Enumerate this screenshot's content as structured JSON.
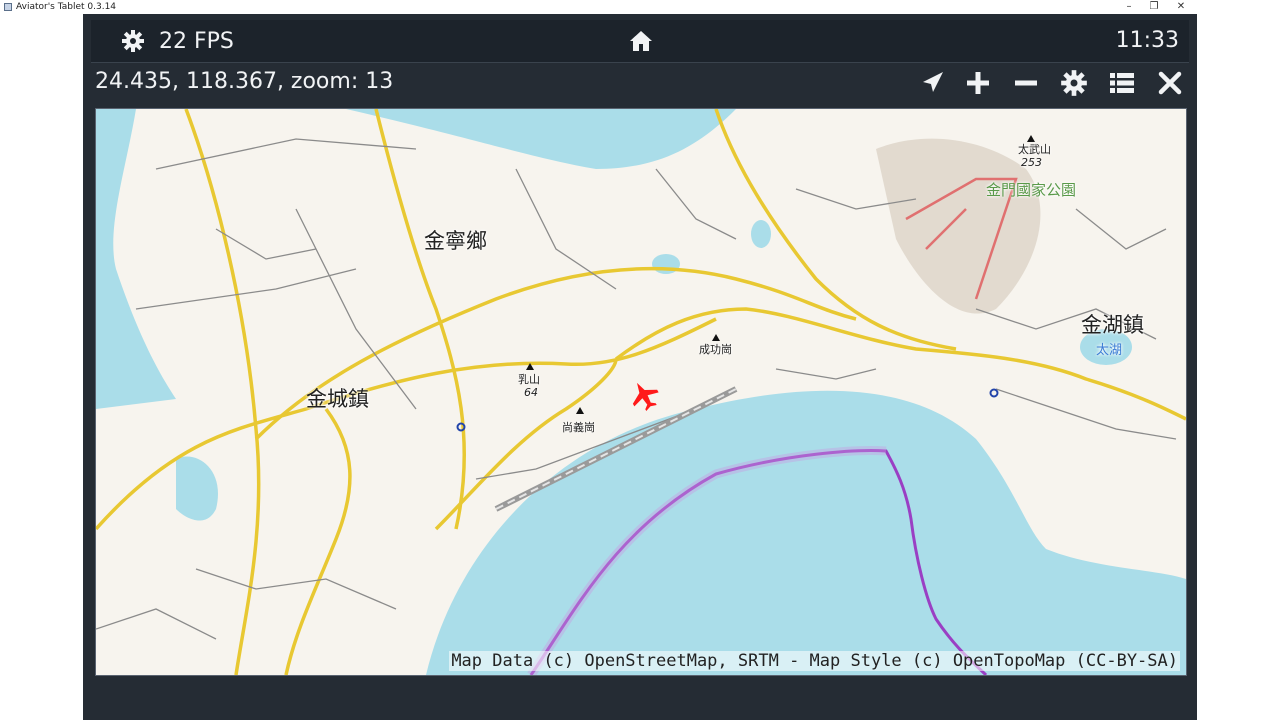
{
  "window": {
    "title": "Aviator's Tablet  0.3.14",
    "controls": [
      "–",
      "❐",
      "✕"
    ]
  },
  "topbar": {
    "settings_icon": "gear-icon",
    "fps": "22 FPS",
    "home_icon": "home-icon",
    "clock": "11:33"
  },
  "coordbar": {
    "text": "24.435, 118.367, zoom: 13",
    "buttons": [
      "locate-icon",
      "zoom-in-icon",
      "zoom-out-icon",
      "gear-icon",
      "list-icon",
      "close-icon"
    ]
  },
  "map": {
    "places": {
      "jinning": "金寧鄉",
      "jincheng": "金城鎮",
      "jinhu": "金湖鎮",
      "park": "金門國家公園",
      "taiwu": "太武山",
      "taiwu_ele": "253",
      "rushan": "乳山",
      "rushan_ele": "64",
      "chenggong": "成功崗",
      "shangyi": "尚義崗",
      "taihu": "太湖"
    },
    "attribution": "Map Data (c) OpenStreetMap, SRTM - Map Style (c) OpenTopoMap (CC-BY-SA)",
    "colors": {
      "sea": "#aadde9",
      "land": "#f7f4ee",
      "road_major": "#e8c832",
      "road_minor": "#8b8b8b",
      "airspace": "#9a3fc4",
      "aircraft": "#ff1a1a"
    }
  }
}
